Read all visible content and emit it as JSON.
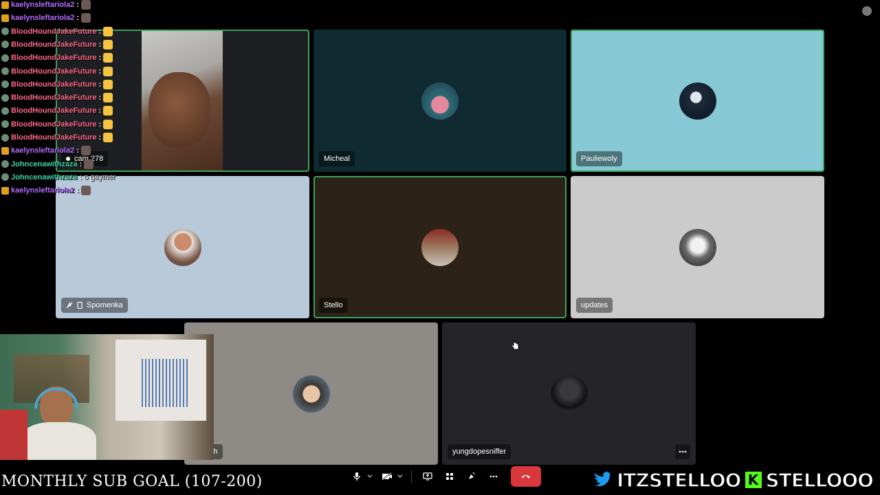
{
  "chat": [
    {
      "user": "kaelynsleftariola2",
      "color": "#b46cff",
      "badge": "crown",
      "message": ""
    },
    {
      "user": "kaelynsleftariola2",
      "color": "#b46cff",
      "badge": "crown",
      "message": ""
    },
    {
      "user": "BloodHoundJakeFuture",
      "color": "#ff6a8a",
      "badge": "leaf",
      "message": ""
    },
    {
      "user": "BloodHoundJakeFuture",
      "color": "#ff6a8a",
      "badge": "leaf",
      "message": ""
    },
    {
      "user": "BloodHoundJakeFuture",
      "color": "#ff6a8a",
      "badge": "leaf",
      "message": ""
    },
    {
      "user": "BloodHoundJakeFuture",
      "color": "#ff6a8a",
      "badge": "leaf",
      "message": ""
    },
    {
      "user": "BloodHoundJakeFuture",
      "color": "#ff6a8a",
      "badge": "leaf",
      "message": ""
    },
    {
      "user": "BloodHoundJakeFuture",
      "color": "#ff6a8a",
      "badge": "leaf",
      "message": ""
    },
    {
      "user": "BloodHoundJakeFuture",
      "color": "#ff6a8a",
      "badge": "leaf",
      "message": ""
    },
    {
      "user": "BloodHoundJakeFuture",
      "color": "#ff6a8a",
      "badge": "leaf",
      "message": ""
    },
    {
      "user": "BloodHoundJakeFuture",
      "color": "#ff6a8a",
      "badge": "leaf",
      "message": ""
    },
    {
      "user": "kaelynsleftariola2",
      "color": "#b46cff",
      "badge": "crown",
      "message": ""
    },
    {
      "user": "Johncenawithzaza",
      "color": "#3fd4a8",
      "badge": "leaf",
      "message": ""
    },
    {
      "user": "Johncenawithzaza",
      "color": "#3fd4a8",
      "badge": "leaf",
      "message": "o gaymer"
    },
    {
      "user": "kaelynsleftariola2",
      "color": "#b46cff",
      "badge": "crown",
      "message": ""
    }
  ],
  "participants": {
    "cam_user": "cam 278",
    "micheal": "Micheal",
    "pauliewoly": "Pauliewoly",
    "spomenka": "Spomenka",
    "stello": "Stello",
    "updates": "updates",
    "sh": "sh",
    "yungdopesniffer": "yungdopesniffer"
  },
  "tile_colors": {
    "cam_bg": "#1e1f22",
    "micheal_bg": "#0f2a30",
    "pauliewoly_bg": "#86c8d4",
    "spomenka_bg": "#b8c9da",
    "stello_bg": "#2c2218",
    "updates_bg": "#cbcbcb",
    "sh_bg": "#8e8a86",
    "yungdopesniffer_bg": "#252529",
    "speaking": "#3ba55c"
  },
  "controls": {
    "icons": [
      "microphone-icon",
      "chevron-down-icon",
      "camera-off-icon",
      "chevron-down-icon",
      "screen-share-icon",
      "activities-icon",
      "soundboard-icon",
      "more-icon"
    ],
    "end_call": "phone-hangup-icon",
    "end_call_color": "#da373c"
  },
  "overlay": {
    "goal": "MONTHLY SUB GOAL (107-200)",
    "twitter_handle": "ITZSTELLOO",
    "kick_handle": "STELLOOO",
    "twitter_color": "#1d9bf0",
    "kick_color": "#53fc18"
  }
}
